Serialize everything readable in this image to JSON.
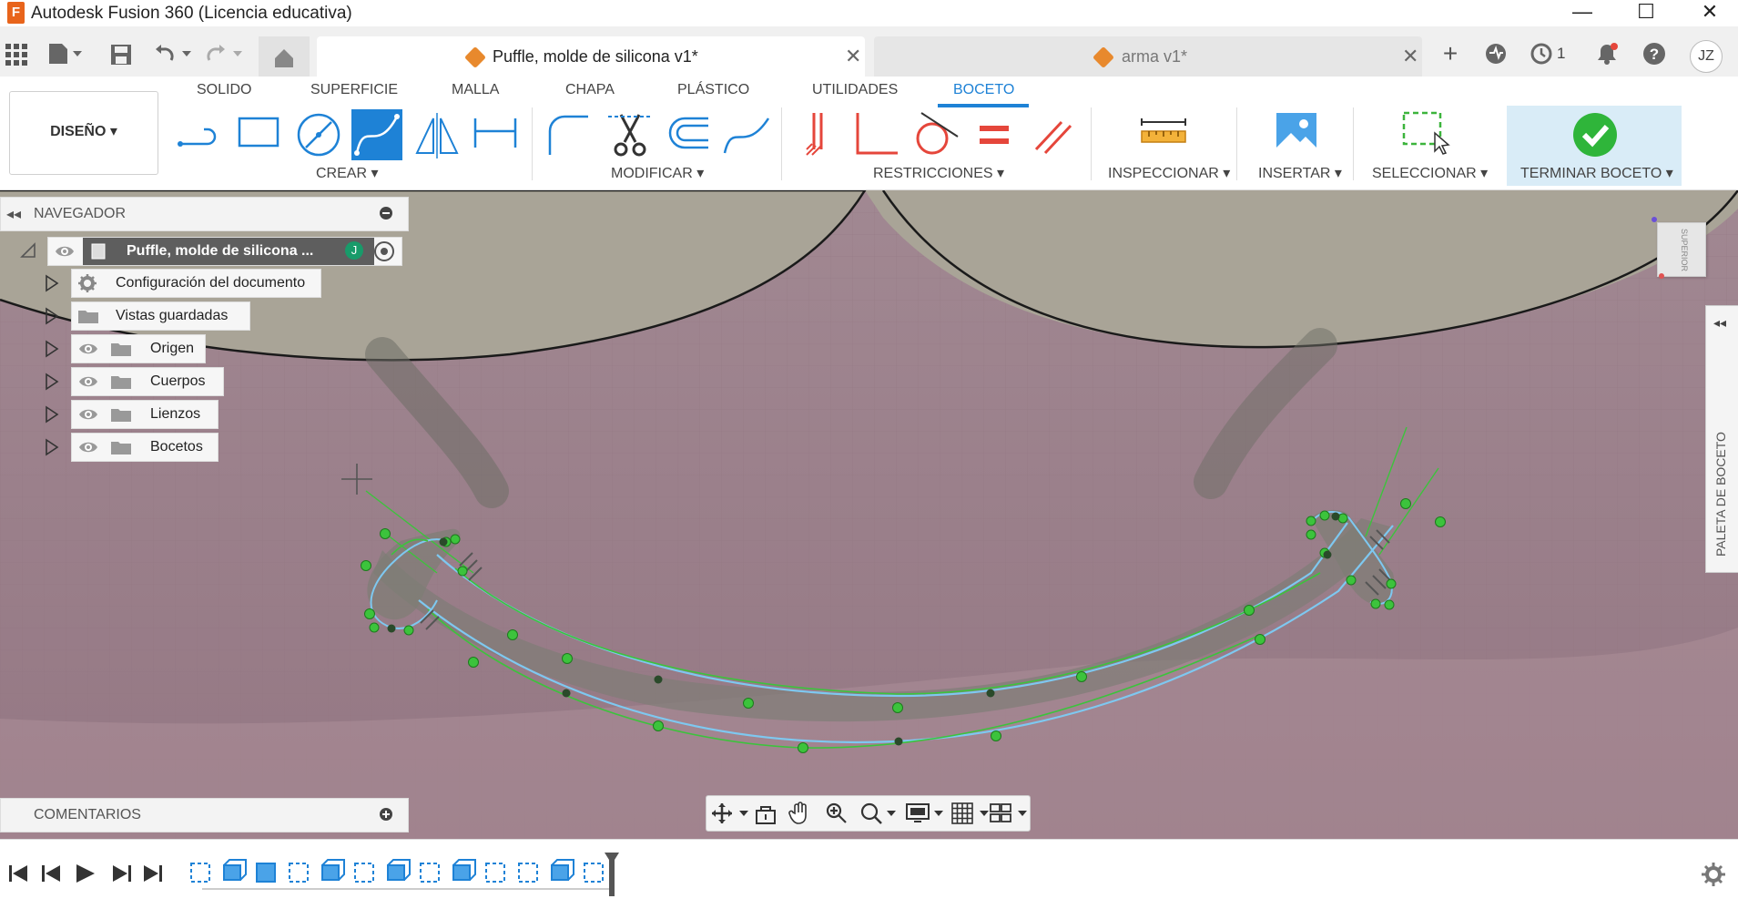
{
  "window": {
    "title": "Autodesk Fusion 360 (Licencia educativa)",
    "minimize_icon": "—",
    "maximize_icon": "☐",
    "close_icon": "✕"
  },
  "quickbar": {
    "user_initials": "JZ",
    "jobs_count": "1"
  },
  "tabs": [
    {
      "label": "Puffle, molde de silicona v1*",
      "active": true
    },
    {
      "label": "arma v1*",
      "active": false
    }
  ],
  "ribbon": {
    "tabs": [
      "SOLIDO",
      "SUPERFICIE",
      "MALLA",
      "CHAPA",
      "PLÁSTICO",
      "UTILIDADES",
      "BOCETO"
    ],
    "active_tab": "BOCETO",
    "workspace": "DISEÑO ▾",
    "groups": {
      "crear": "CREAR ▾",
      "modificar": "MODIFICAR ▾",
      "restricciones": "RESTRICCIONES ▾",
      "inspeccionar": "INSPECCIONAR ▾",
      "insertar": "INSERTAR ▾",
      "seleccionar": "SELECCIONAR ▾",
      "terminar": "TERMINAR BOCETO ▾"
    }
  },
  "navigator": {
    "title": "NAVEGADOR",
    "root": "Puffle, molde de silicona ...",
    "items": [
      {
        "label": "Configuración del documento",
        "icon": "gear-icon"
      },
      {
        "label": "Vistas guardadas",
        "icon": "folder-icon"
      },
      {
        "label": "Origen",
        "icon": "folder-icon"
      },
      {
        "label": "Cuerpos",
        "icon": "folder-icon"
      },
      {
        "label": "Lienzos",
        "icon": "folder-icon"
      },
      {
        "label": "Bocetos",
        "icon": "folder-icon"
      }
    ]
  },
  "comments": {
    "title": "COMENTARIOS"
  },
  "palette": {
    "title": "PALETA DE BOCETO"
  },
  "viewcube": {
    "face": "SUPERIOR"
  },
  "colors": {
    "accent": "#1e82d6",
    "active_tool": "#1e82d6",
    "terminar_bg": "#d9ecf7",
    "canvas_pink": "#9e7f8a",
    "canvas_gray": "#a39e93",
    "sketch_line": "#7ec8f0",
    "sketch_point": "#3cc33c"
  }
}
